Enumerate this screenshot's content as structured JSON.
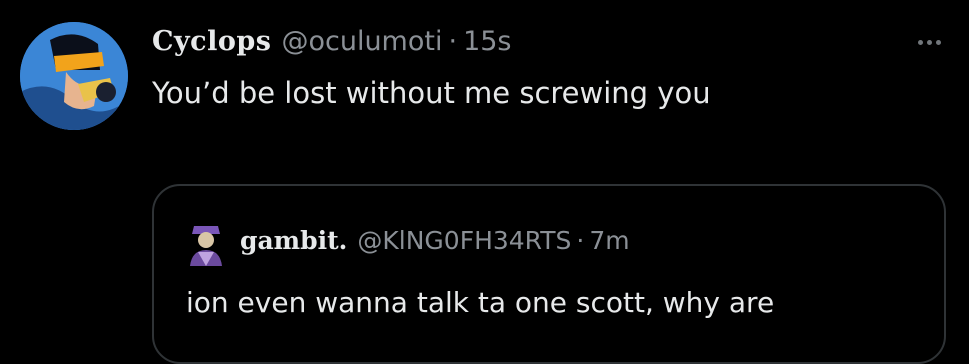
{
  "tweet": {
    "display_name": "Cyclops",
    "handle": "@oculumoti",
    "separator": "·",
    "time": "15s",
    "text": "You’d be lost without me screwing you",
    "more_icon": "more-horizontal-icon"
  },
  "quoted_tweet": {
    "display_name": "gambit.",
    "handle": "@KlNG0FH34RTS",
    "separator": "·",
    "time": "7m",
    "text": "ion even wanna talk ta one scott, why are"
  },
  "colors": {
    "background": "#000000",
    "primary_text": "#e7e9ea",
    "secondary_text": "#8b9096",
    "border": "#2f3336"
  }
}
